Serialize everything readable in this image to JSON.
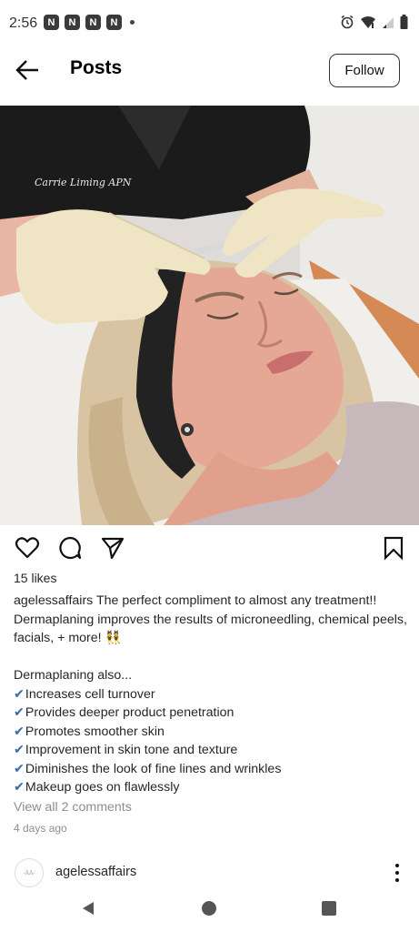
{
  "status_bar": {
    "time": "2:56",
    "notification_icons": [
      "N",
      "N",
      "N",
      "N"
    ],
    "system_icons": [
      "alarm-icon",
      "wifi-icon",
      "signal-icon",
      "battery-icon"
    ]
  },
  "header": {
    "title": "Posts",
    "follow_label": "Follow"
  },
  "post": {
    "photo_badge_text": "Carrie Liming APN",
    "likes": "15 likes",
    "username": "agelessaffairs",
    "caption_line1": "The perfect compliment to almost any treatment!! Dermaplaning improves the results of microneedling, chemical peels, facials, + more! 👯",
    "caption_heading": "Dermaplaning also...",
    "benefits": [
      "Increases cell turnover",
      "Provides deeper product penetration",
      "Promotes smoother skin",
      "Improvement in skin tone and texture",
      "Diminishes the look of fine lines and wrinkles",
      "Makeup goes on flawlessly"
    ],
    "check_glyph": "✔",
    "view_comments": "View all 2 comments",
    "time_ago": "4 days ago"
  },
  "next_post": {
    "username": "agelessaffairs",
    "avatar_text": "-AA-"
  },
  "colors": {
    "check": "#3b6ea8",
    "muted": "#8e8e8e",
    "text": "#262626"
  }
}
